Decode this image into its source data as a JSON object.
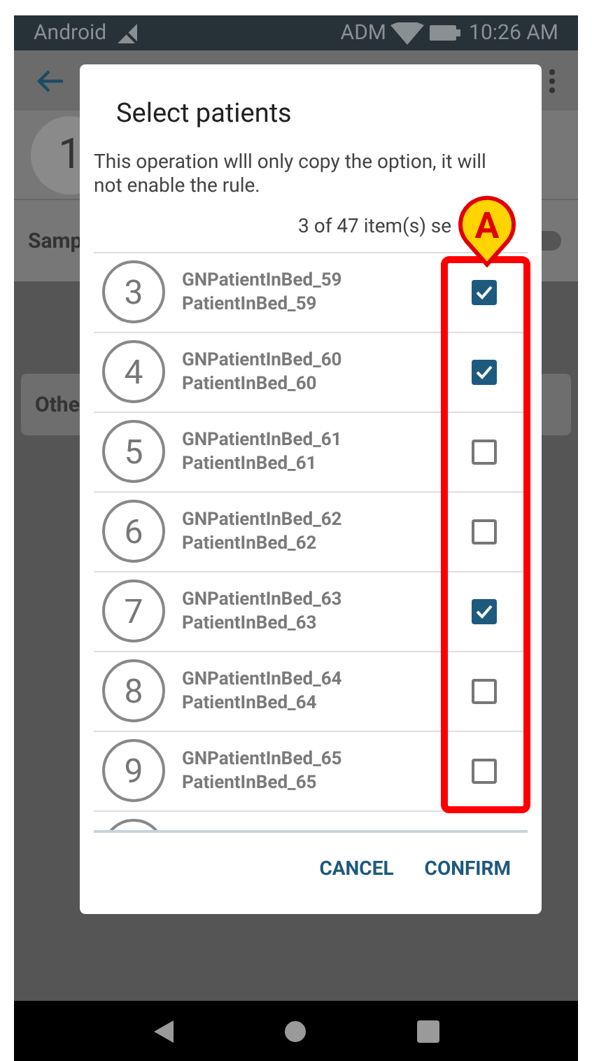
{
  "status_bar": {
    "carrier": "Android",
    "operator": "ADM",
    "time": "10:26 AM"
  },
  "background": {
    "bed_number": "1",
    "row_label": "Samp",
    "card_label": "Othe",
    "toggle_on": false
  },
  "dialog": {
    "title": "Select patients",
    "message": "This operation wlll only copy the option, it will not enable the rule.",
    "count": "3 of 47 item(s) se",
    "patients": [
      {
        "bed": "3",
        "name": "GNPatientInBed_59",
        "subtitle": "PatientInBed_59",
        "checked": true
      },
      {
        "bed": "4",
        "name": "GNPatientInBed_60",
        "subtitle": "PatientInBed_60",
        "checked": true
      },
      {
        "bed": "5",
        "name": "GNPatientInBed_61",
        "subtitle": "PatientInBed_61",
        "checked": false
      },
      {
        "bed": "6",
        "name": "GNPatientInBed_62",
        "subtitle": "PatientInBed_62",
        "checked": false
      },
      {
        "bed": "7",
        "name": "GNPatientInBed_63",
        "subtitle": "PatientInBed_63",
        "checked": true
      },
      {
        "bed": "8",
        "name": "GNPatientInBed_64",
        "subtitle": "PatientInBed_64",
        "checked": false
      },
      {
        "bed": "9",
        "name": "GNPatientInBed_65",
        "subtitle": "PatientInBed_65",
        "checked": false
      }
    ],
    "buttons": [
      "CANCEL",
      "CONFIRM"
    ]
  },
  "callout": {
    "label": "A"
  }
}
